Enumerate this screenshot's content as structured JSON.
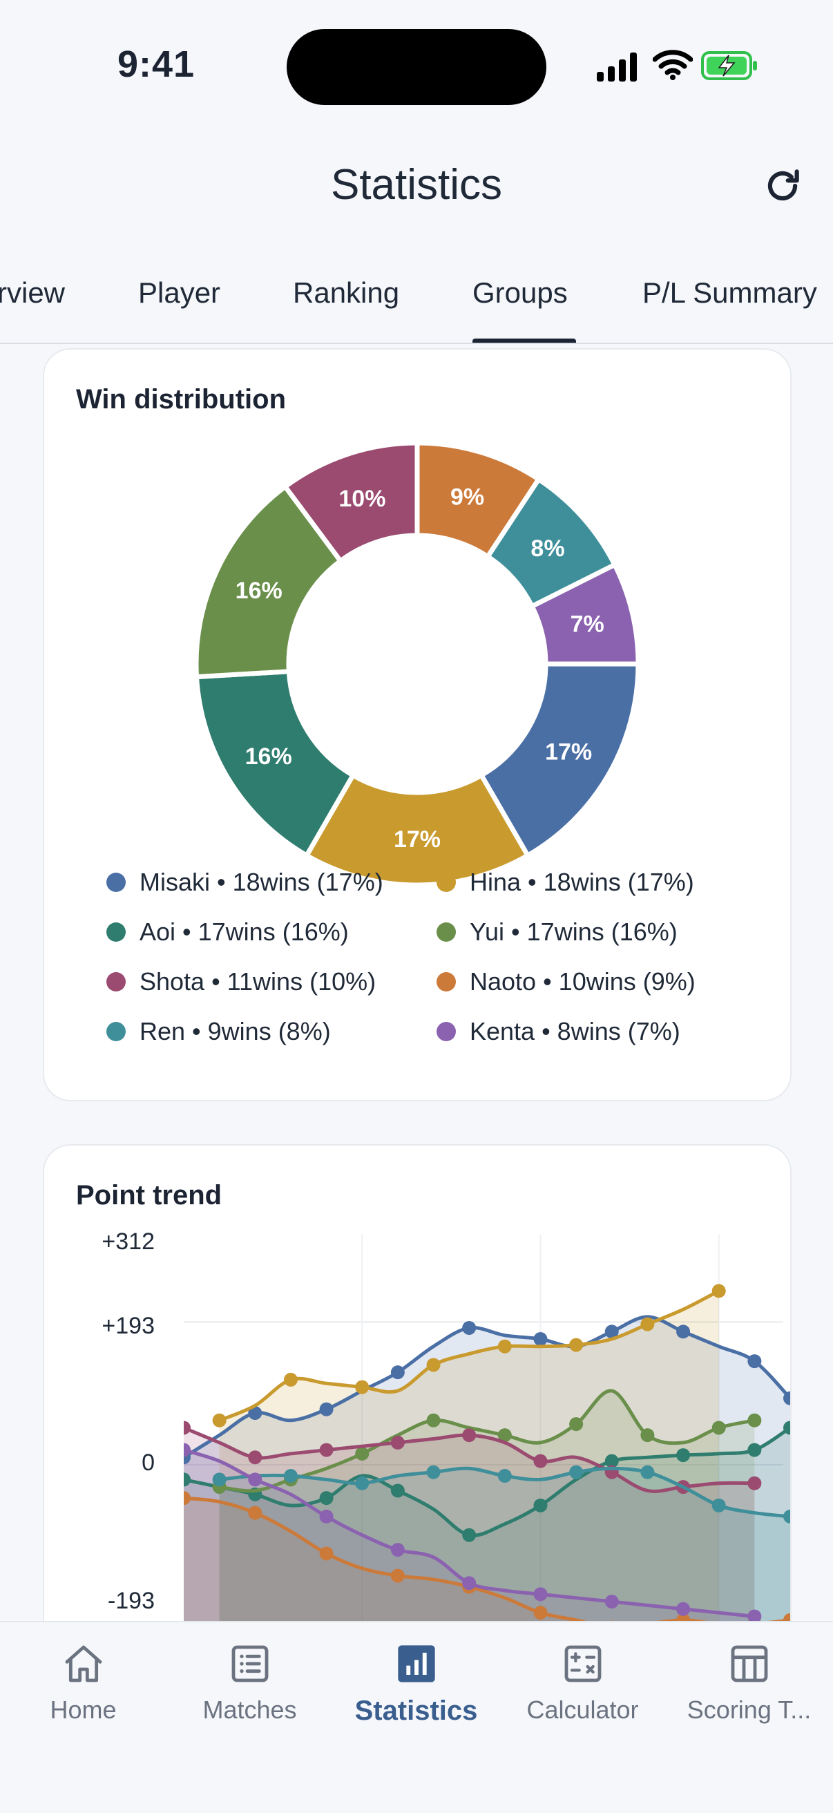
{
  "status_bar": {
    "time": "9:41"
  },
  "header": {
    "title": "Statistics"
  },
  "tabs": [
    "rview",
    "Player",
    "Ranking",
    "Groups",
    "P/L Summary"
  ],
  "active_tab": "Groups",
  "win_distribution": {
    "title": "Win distribution",
    "slices": [
      {
        "name": "Misaki",
        "wins": 18,
        "pct": 17,
        "label": "17%",
        "color": "#4a6fa5",
        "legend": "Misaki • 18wins (17%)"
      },
      {
        "name": "Hina",
        "wins": 18,
        "pct": 17,
        "label": "17%",
        "color": "#c99a2e",
        "legend": "Hina • 18wins (17%)"
      },
      {
        "name": "Aoi",
        "wins": 17,
        "pct": 16,
        "label": "16%",
        "color": "#2e7d6e",
        "legend": "Aoi • 17wins (16%)"
      },
      {
        "name": "Yui",
        "wins": 17,
        "pct": 16,
        "label": "16%",
        "color": "#6a8f4a",
        "legend": "Yui • 17wins (16%)"
      },
      {
        "name": "Shota",
        "wins": 11,
        "pct": 10,
        "label": "10%",
        "color": "#9b4a70",
        "legend": "Shota • 11wins (10%)"
      },
      {
        "name": "Naoto",
        "wins": 10,
        "pct": 9,
        "label": "9%",
        "color": "#cc7a3a",
        "legend": "Naoto • 10wins (9%)"
      },
      {
        "name": "Ren",
        "wins": 9,
        "pct": 8,
        "label": "8%",
        "color": "#3f8f9b",
        "legend": "Ren • 9wins (8%)"
      },
      {
        "name": "Kenta",
        "wins": 8,
        "pct": 7,
        "label": "7%",
        "color": "#8a62b0",
        "legend": "Kenta • 8wins (7%)"
      }
    ]
  },
  "point_trend": {
    "title": "Point trend",
    "yticks": [
      "+312",
      "+193",
      "0",
      "-193"
    ]
  },
  "chart_data": [
    {
      "type": "pie",
      "title": "Win distribution",
      "categories": [
        "Misaki",
        "Hina",
        "Aoi",
        "Yui",
        "Shota",
        "Naoto",
        "Ren",
        "Kenta"
      ],
      "values": [
        18,
        18,
        17,
        17,
        11,
        10,
        9,
        8
      ],
      "percent": [
        17,
        17,
        16,
        16,
        10,
        9,
        8,
        7
      ],
      "donut": true,
      "legend": "bottom"
    },
    {
      "type": "area",
      "title": "Point trend",
      "ylim": [
        -230,
        312
      ],
      "y_tick_labels": [
        "+312",
        "+193",
        "0",
        "-193"
      ],
      "grid": true,
      "series": [
        {
          "name": "Misaki",
          "color": "#4a6fa5",
          "x": [
            0,
            1,
            2,
            3,
            4,
            5,
            6,
            7,
            8,
            9,
            10,
            11,
            12,
            13,
            14,
            15,
            16,
            17
          ],
          "y": [
            10,
            40,
            70,
            60,
            75,
            100,
            125,
            160,
            185,
            175,
            170,
            160,
            180,
            200,
            180,
            160,
            140,
            90
          ]
        },
        {
          "name": "Hina",
          "color": "#c99a2e",
          "x": [
            1,
            2,
            3,
            4,
            5,
            6,
            7,
            8,
            9,
            10,
            11,
            12,
            13,
            14,
            15
          ],
          "y": [
            60,
            80,
            115,
            110,
            105,
            100,
            135,
            150,
            160,
            160,
            162,
            170,
            190,
            210,
            235
          ]
        },
        {
          "name": "Aoi",
          "color": "#2e7d6e",
          "x": [
            0,
            1,
            2,
            3,
            4,
            5,
            6,
            7,
            8,
            9,
            10,
            11,
            12,
            13,
            14,
            15,
            16,
            17
          ],
          "y": [
            -20,
            -30,
            -40,
            -55,
            -45,
            -15,
            -35,
            -60,
            -95,
            -80,
            -55,
            -20,
            5,
            10,
            13,
            15,
            20,
            50
          ]
        },
        {
          "name": "Yui",
          "color": "#6a8f4a",
          "x": [
            1,
            2,
            3,
            4,
            5,
            6,
            7,
            8,
            9,
            10,
            11,
            12,
            13,
            14,
            15,
            16
          ],
          "y": [
            -30,
            -35,
            -20,
            -5,
            15,
            40,
            60,
            50,
            40,
            30,
            55,
            100,
            40,
            30,
            50,
            60
          ]
        },
        {
          "name": "Shota",
          "color": "#9b4a70",
          "x": [
            0,
            1,
            2,
            3,
            4,
            5,
            6,
            7,
            8,
            9,
            10,
            11,
            12,
            13,
            14,
            15,
            16
          ],
          "y": [
            50,
            30,
            10,
            15,
            20,
            25,
            30,
            35,
            40,
            30,
            5,
            10,
            -10,
            -35,
            -30,
            -25,
            -25
          ]
        },
        {
          "name": "Naoto",
          "color": "#cc7a3a",
          "x": [
            0,
            1,
            2,
            3,
            4,
            5,
            6,
            7,
            8,
            9,
            10,
            11,
            12,
            13,
            14,
            15,
            16,
            17
          ],
          "y": [
            -45,
            -50,
            -65,
            -90,
            -120,
            -140,
            -150,
            -155,
            -165,
            -180,
            -200,
            -210,
            -220,
            -215,
            -210,
            -215,
            -215,
            -210
          ]
        },
        {
          "name": "Ren",
          "color": "#3f8f9b",
          "x": [
            1,
            2,
            3,
            4,
            5,
            6,
            7,
            8,
            9,
            10,
            11,
            12,
            13,
            14,
            15,
            16,
            17
          ],
          "y": [
            -20,
            -15,
            -15,
            -20,
            -25,
            -15,
            -10,
            -5,
            -15,
            -20,
            -10,
            -5,
            -10,
            -30,
            -55,
            -65,
            -70
          ]
        },
        {
          "name": "Kenta",
          "color": "#8a62b0",
          "x": [
            0,
            1,
            2,
            3,
            4,
            5,
            6,
            7,
            8,
            9,
            10,
            11,
            12,
            13,
            14,
            15,
            16
          ],
          "y": [
            20,
            5,
            -20,
            -40,
            -70,
            -95,
            -115,
            -125,
            -160,
            -170,
            -175,
            -180,
            -185,
            -190,
            -195,
            -200,
            -205
          ]
        }
      ]
    }
  ],
  "bottom_nav": [
    {
      "label": "Home",
      "icon": "home-icon"
    },
    {
      "label": "Matches",
      "icon": "list-icon"
    },
    {
      "label": "Statistics",
      "icon": "bar-chart-icon",
      "active": true
    },
    {
      "label": "Calculator",
      "icon": "calculator-icon"
    },
    {
      "label": "Scoring T...",
      "icon": "table-icon"
    }
  ]
}
